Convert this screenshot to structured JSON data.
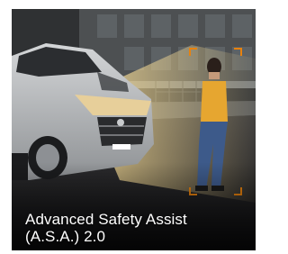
{
  "card": {
    "caption_line1": "Advanced Safety Assist",
    "caption_line2": "(A.S.A.) 2.0",
    "image_alt": "Car headlights detecting a pedestrian at night"
  },
  "colors": {
    "detection_bracket": "#e8820e",
    "headlight_beam": "#f6d58a",
    "car_body": "#b9bcbf",
    "pedestrian_top": "#e6a630",
    "pedestrian_jeans": "#3d5a8a"
  }
}
